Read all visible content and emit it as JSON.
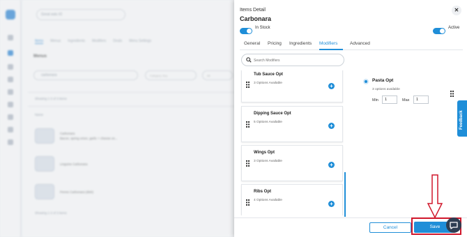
{
  "background": {
    "location_select": "Great eats #2",
    "tabs": [
      "Items",
      "Menus",
      "Ingredients",
      "Modifiers",
      "Deals",
      "Menu Settings"
    ],
    "menus_label": "Menus",
    "search_value": "carbonara",
    "filter_category": "Category: Any",
    "filter_all": "All",
    "showing_top": "Showing 1-3 of 3 items",
    "column_name": "Name",
    "rows": [
      {
        "name": "Carbonara",
        "desc": "Bacon, spring onion, garlic + cheese on..."
      },
      {
        "name": "Linguine Carbonara",
        "desc": ""
      },
      {
        "name": "Penne Carbonara (dish)",
        "desc": ""
      }
    ],
    "showing_bottom": "Showing 1-3 of 3 items"
  },
  "drawer": {
    "header_small": "Items Detail",
    "title": "Carbonara",
    "in_stock_label": "In Stock",
    "active_label": "Active",
    "tabs": [
      "General",
      "Pricing",
      "Ingredients",
      "Modifiers",
      "Advanced"
    ],
    "active_tab": "Modifiers",
    "search_placeholder": "Search Modifiers",
    "modifiers": [
      {
        "name": "Tub Sauce Opt",
        "options": "3 Options Available"
      },
      {
        "name": "Dipping Sauce Opt",
        "options": "5 Options Available"
      },
      {
        "name": "Wings Opt",
        "options": "3 Options Available"
      },
      {
        "name": "Ribs Opt",
        "options": "4 Options Available"
      }
    ],
    "selected": {
      "name": "Pasta Opt",
      "options": "3 options available",
      "min_label": "Min",
      "min_value": "1",
      "max_label": "Max",
      "max_value": "1"
    },
    "cancel_label": "Cancel",
    "save_label": "Save"
  },
  "feedback_label": "Feedback",
  "colors": {
    "accent": "#1f8ed8",
    "highlight": "#d0172b",
    "chat": "#2f3e52"
  }
}
